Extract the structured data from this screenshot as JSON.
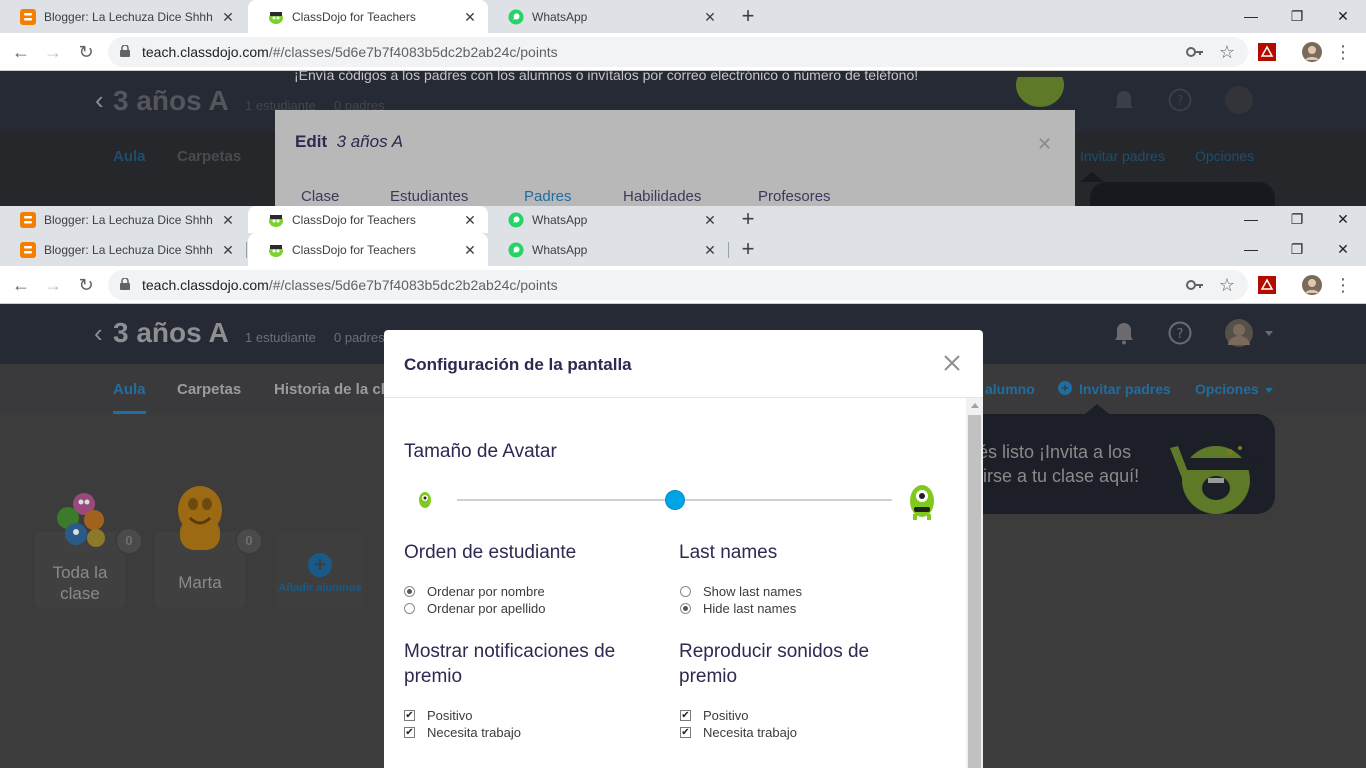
{
  "browser": {
    "tabs": [
      {
        "label": "Blogger: La Lechuza Dice Shhh - (",
        "icon": "blogger-icon"
      },
      {
        "label": "ClassDojo for Teachers",
        "icon": "classdojo-icon"
      },
      {
        "label": "WhatsApp",
        "icon": "whatsapp-icon"
      }
    ],
    "new_tab": "+",
    "url_host": "teach.classdojo.com",
    "url_path": "/#/classes/5d6e7b7f4083b5dc2b2ab24c/points",
    "window_controls": {
      "minimize": "—",
      "restore": "❐",
      "close": "✕"
    }
  },
  "background_page": {
    "banner_text": "¡Envía códigos a los padres con los alumnos o invítalos por correo electrónico o número de teléfono!",
    "edit_dialog": {
      "title_prefix": "Edit",
      "title_class": "3 años A",
      "tabs": [
        "Clase",
        "Estudiantes",
        "Padres",
        "Habilidades",
        "Profesores"
      ],
      "active_tab": "Padres"
    }
  },
  "app": {
    "back": "‹",
    "class_name": "3 años A",
    "students_count": "1 estudiante",
    "parents_count": "0 padres",
    "nav": [
      "Aula",
      "Carpetas",
      "Historia de la cl"
    ],
    "nav_active": "Aula",
    "add_student_partial": "alumno",
    "invite_parents": "Invitar padres",
    "options": "Opciones",
    "invite_bubble_line1": "tés listo ¡Invita a los",
    "invite_bubble_line2": "nirse a tu clase aquí!",
    "students": [
      {
        "name": "Toda la clase",
        "points": "0"
      },
      {
        "name": "Marta",
        "points": "0"
      }
    ],
    "add_students": "Añadir alumnos"
  },
  "modal": {
    "title": "Configuración de la pantalla",
    "avatar_size_label": "Tamaño de Avatar",
    "avatar_size_value": 0.5,
    "student_order": {
      "label": "Orden de estudiante",
      "options": [
        "Ordenar por nombre",
        "Ordenar por apellido"
      ],
      "selected": 0
    },
    "last_names": {
      "label": "Last names",
      "options": [
        "Show last names",
        "Hide last names"
      ],
      "selected": 1
    },
    "award_notifications": {
      "label": "Mostrar notificaciones de premio",
      "options": [
        "Positivo",
        "Necesita trabajo"
      ],
      "checked": [
        true,
        true
      ]
    },
    "award_sounds": {
      "label": "Reproducir sonidos de premio",
      "options": [
        "Positivo",
        "Necesita trabajo"
      ],
      "checked": [
        true,
        true
      ]
    }
  }
}
